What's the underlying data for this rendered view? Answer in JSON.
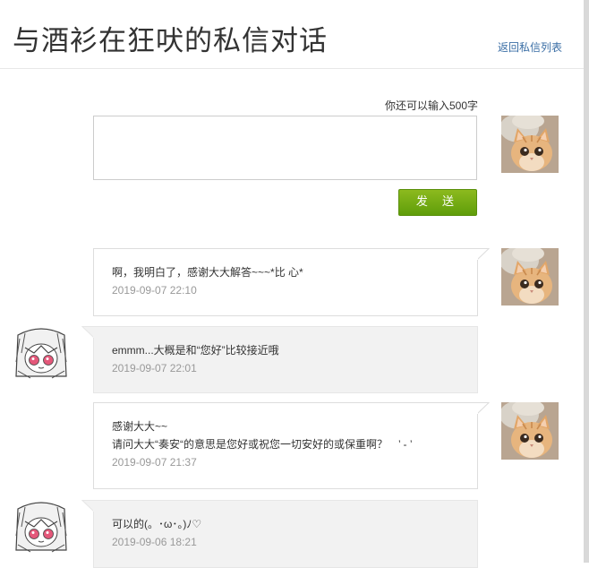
{
  "header": {
    "title": "与酒衫在狂吠的私信对话",
    "back_link": "返回私信列表"
  },
  "compose": {
    "remaining": "你还可以输入500字",
    "placeholder": "",
    "send_label": "发 送"
  },
  "messages": [
    {
      "side": "mine",
      "lines": [
        "啊，我明白了，感谢大大解答~~~*比 心*"
      ],
      "time": "2019-09-07 22:10"
    },
    {
      "side": "theirs",
      "lines": [
        "emmm...大概是和“您好”比较接近哦"
      ],
      "time": "2019-09-07 22:01"
    },
    {
      "side": "mine",
      "lines": [
        "感谢大大~~",
        "请问大大“奏安“的意思是您好或祝您一切安好的或保重啊？　’ - ’"
      ],
      "time": "2019-09-07 21:37"
    },
    {
      "side": "theirs",
      "lines": [
        "可以的(。･ω･。)ﾉ♡"
      ],
      "time": "2019-09-06 18:21"
    }
  ],
  "icons": {
    "my_avatar": "kitten-avatar",
    "their_avatar": "anime-girl-avatar",
    "send": "send-button"
  },
  "colors": {
    "send_button": "#6aa512",
    "link": "#3a6ea5",
    "theirs_bubble": "#f2f2f2",
    "timestamp": "#999999"
  }
}
